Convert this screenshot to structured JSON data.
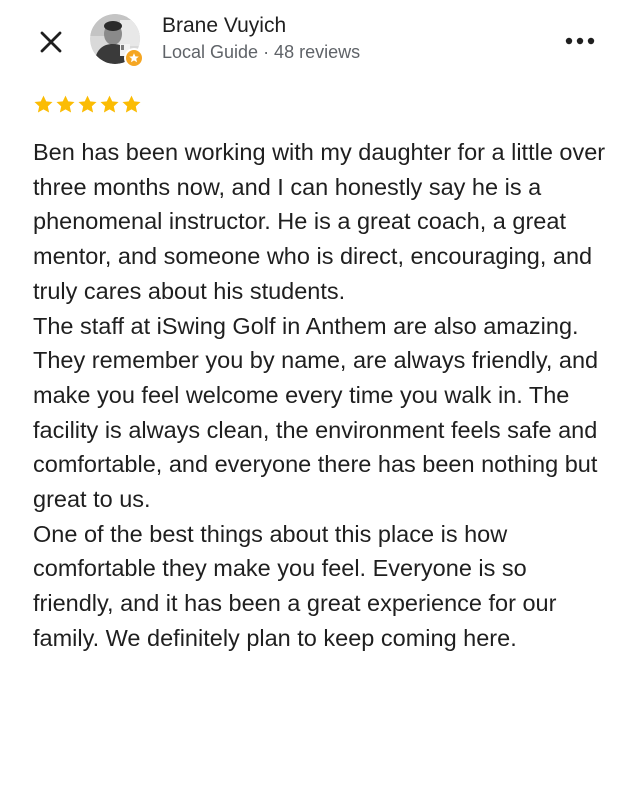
{
  "header": {
    "close_icon": "close-icon",
    "reviewer_name": "Brane Vuyich",
    "reviewer_meta": "Local Guide · 48 reviews",
    "badge_icon": "local-guide-badge-icon",
    "more_icon": "more-options-icon"
  },
  "review": {
    "rating": 5,
    "rating_max": 5,
    "star_color": "#fbbc04",
    "paragraphs": [
      "Ben has been working with my daughter for a little over three months now, and I can honestly say he is a phenomenal instructor. He is a great coach, a great mentor, and someone who is direct, encouraging, and truly cares about his students.",
      "The staff at iSwing Golf in Anthem are also amazing. They remember you by name, are always friendly, and make you feel welcome every time you walk in. The facility is always clean, the environment feels safe and comfortable, and everyone there has been nothing but great to us.",
      "One of the best things about this place is how comfortable they make you feel. Everyone is so friendly, and it has been a great experience for our family. We definitely plan to keep coming here."
    ]
  },
  "colors": {
    "text_primary": "#1f1f1f",
    "text_secondary": "#5f6368",
    "badge": "#f5a623"
  }
}
